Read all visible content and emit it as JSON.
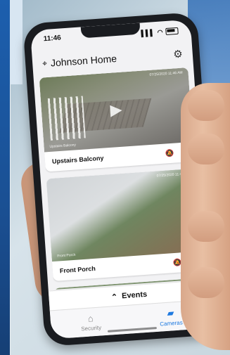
{
  "status_bar": {
    "time": "11:46",
    "signal": "▌▌▌",
    "wifi": "◠"
  },
  "header": {
    "location": "Johnson Home"
  },
  "cameras": [
    {
      "name": "Upstairs Balcony",
      "overlay_timestamp": "07/25/2020 11:46 AM",
      "overlay_label": "Upstairs Balcony"
    },
    {
      "name": "Front Porch",
      "overlay_timestamp": "07/25/2020 11:46 AM",
      "overlay_label": "Front Porch"
    }
  ],
  "events": {
    "label": "Events"
  },
  "tabs": [
    {
      "label": "Security",
      "icon": "home-icon"
    },
    {
      "label": "Cameras",
      "icon": "camera-icon",
      "active": true
    }
  ],
  "colors": {
    "accent": "#1f7ae0",
    "frame_blue": "#1c5fae"
  }
}
